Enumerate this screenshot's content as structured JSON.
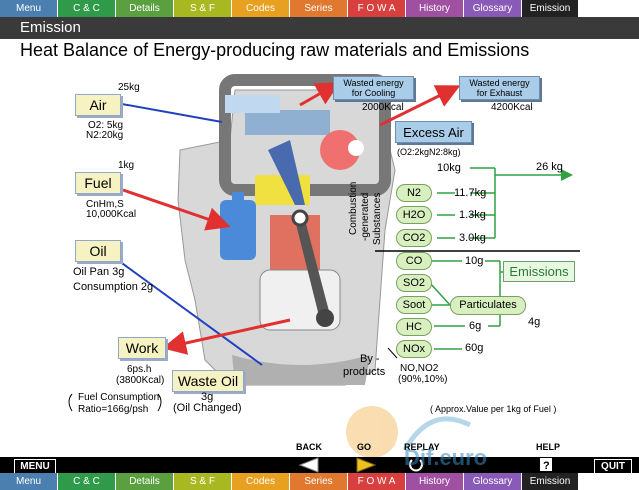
{
  "tabs": [
    {
      "label": "Menu",
      "color": "#4a7fb0"
    },
    {
      "label": "C & C",
      "color": "#2f9a4a"
    },
    {
      "label": "Details",
      "color": "#5aa040"
    },
    {
      "label": "S & F",
      "color": "#a8b820"
    },
    {
      "label": "Codes",
      "color": "#e8a020"
    },
    {
      "label": "Series",
      "color": "#e07830"
    },
    {
      "label": "F O W A",
      "color": "#d84040"
    },
    {
      "label": "History",
      "color": "#a050a0"
    },
    {
      "label": "Glossary",
      "color": "#8a5ab8"
    },
    {
      "label": "Emission",
      "color": "#222222"
    }
  ],
  "bottom_tabs": [
    {
      "label": "Menu",
      "color": "#4a7fb0"
    },
    {
      "label": "C & C",
      "color": "#2f9a4a"
    },
    {
      "label": "Details",
      "color": "#5aa040"
    },
    {
      "label": "S & F",
      "color": "#a8b820"
    },
    {
      "label": "Codes",
      "color": "#e8a020"
    },
    {
      "label": "Series",
      "color": "#e07830"
    },
    {
      "label": "F O W A",
      "color": "#d84040"
    },
    {
      "label": "History",
      "color": "#a050a0"
    },
    {
      "label": "Glossary",
      "color": "#8a5ab8"
    },
    {
      "label": "Emission",
      "color": "#222222"
    }
  ],
  "header": "Emission",
  "title": "Heat Balance of Energy-producing  raw materials and Emissions",
  "inputs": {
    "air": {
      "label": "Air",
      "amount": "25kg",
      "comp1": "O2:  5kg",
      "comp2": "N2:20kg"
    },
    "fuel": {
      "label": "Fuel",
      "amount": "1kg",
      "comp1": "CnHm,S",
      "comp2": "10,000Kcal"
    },
    "oil": {
      "label": "Oil",
      "line1": "Oil Pan 3g",
      "line2": "Consumption 2g"
    },
    "work": {
      "label": "Work",
      "line1": "6ps.h",
      "line2": "(3800Kcal)"
    },
    "waste_oil": {
      "label": "Waste Oil",
      "line1": "3g",
      "line2": "(Oil Changed)"
    },
    "fuel_consumption": {
      "line1": "Fuel Consumption",
      "line2": "Ratio=166g/psh"
    }
  },
  "wasted": {
    "cooling": {
      "line1": "Wasted energy",
      "line2": "for Cooling",
      "value": "2000Kcal"
    },
    "exhaust": {
      "line1": "Wasted energy",
      "line2": "for Exhaust",
      "value": "4200Kcal"
    }
  },
  "excess_air": {
    "label": "Excess Air",
    "detail": "(O2:2kgN2:8kg)"
  },
  "combustion": {
    "label1": "Combustion",
    "label2": "-generated",
    "label3": "Substances",
    "total": "26 kg",
    "items": [
      {
        "name": "N2",
        "value": "10kg"
      },
      {
        "name": "N2",
        "value": "11.7kg"
      },
      {
        "name": "H2O",
        "value": "1.3kg"
      },
      {
        "name": "CO2",
        "value": "3.0kg"
      }
    ]
  },
  "emissions": {
    "label": "Emissions",
    "items": [
      {
        "name": "CO",
        "value": "10g"
      },
      {
        "name": "SO2",
        "value": ""
      },
      {
        "name": "Soot",
        "value": ""
      },
      {
        "name": "HC",
        "value": "6g"
      },
      {
        "name": "NOx",
        "value": "60g"
      }
    ],
    "particulates": "Particulates",
    "particulates_value": "4g",
    "nox_detail1": "NO,NO2",
    "nox_detail2": "(90%,10%)"
  },
  "byproducts": {
    "line1": "By -",
    "line2": "products"
  },
  "note": "( Approx.Value per 1kg of Fuel )",
  "nav": {
    "back": "BACK",
    "go": "GO",
    "replay": "REPLAY",
    "help": "HELP",
    "menu": "MENU",
    "quit": "QUIT"
  },
  "watermark": "Dif.euro",
  "colors": {
    "header_bg": "#3a3a3a",
    "label_bg": "#f6f2c2",
    "pill_bg": "#d8f0c0",
    "arrow_red": "#e03030",
    "line_blue": "#2040c0",
    "line_green": "#30a040"
  }
}
